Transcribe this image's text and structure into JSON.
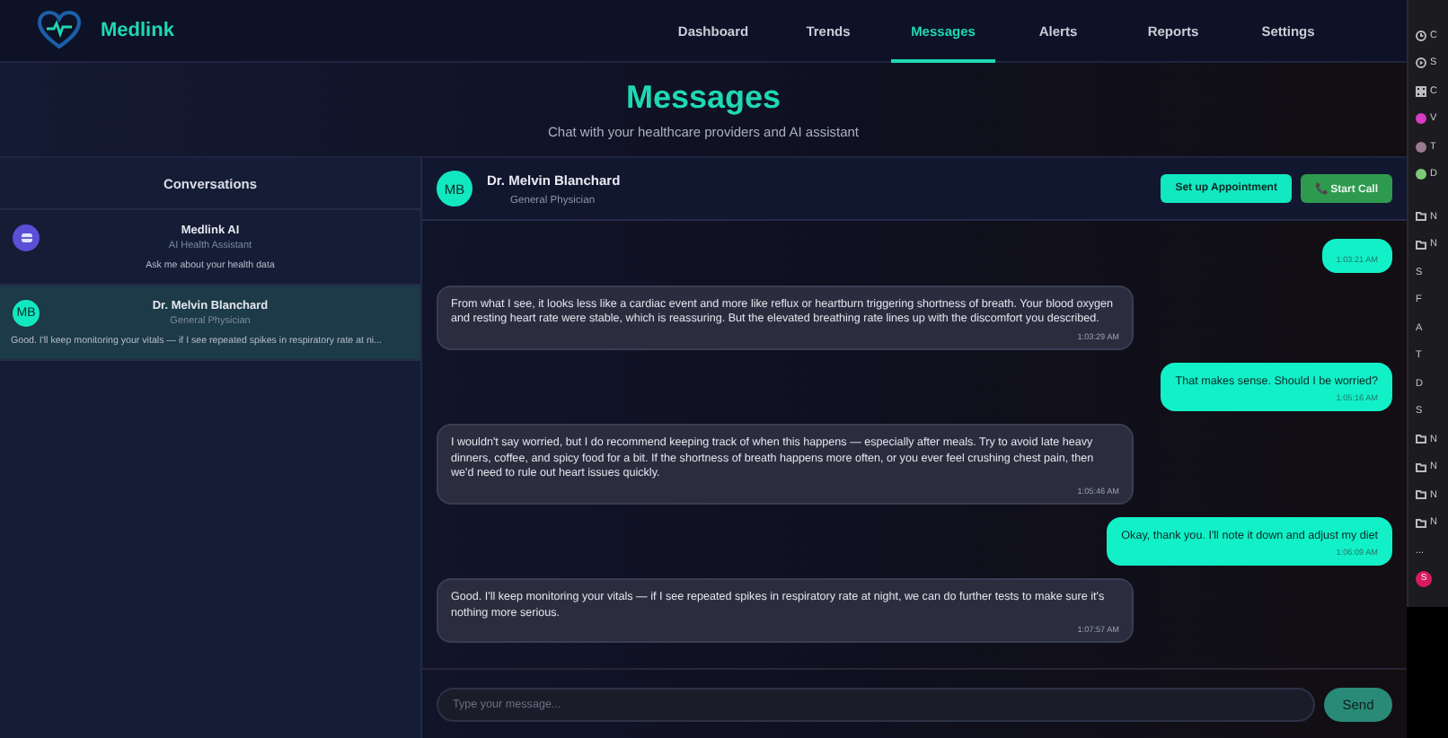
{
  "brand": {
    "name": "Medlink"
  },
  "nav": [
    {
      "label": "Dashboard",
      "selected": false
    },
    {
      "label": "Trends",
      "selected": false
    },
    {
      "label": "Messages",
      "selected": true
    },
    {
      "label": "Alerts",
      "selected": false
    },
    {
      "label": "Reports",
      "selected": false
    },
    {
      "label": "Settings",
      "selected": false
    }
  ],
  "page": {
    "title": "Messages",
    "subtitle": "Chat with your healthcare providers and AI assistant"
  },
  "conversations": {
    "title": "Conversations",
    "items": [
      {
        "kind": "ai",
        "name": "Medlink AI",
        "role": "AI Health Assistant",
        "preview": "Ask me about your health data",
        "selected": false
      },
      {
        "kind": "person",
        "initials": "MB",
        "name": "Dr. Melvin Blanchard",
        "role": "General Physician",
        "preview": "Good. I'll keep monitoring your vitals — if I see repeated spikes in respiratory rate at ni...",
        "selected": true
      }
    ]
  },
  "chat": {
    "initials": "MB",
    "name": "Dr. Melvin Blanchard",
    "role": "General Physician",
    "buttons": [
      {
        "kind": "secondary",
        "label": "Set up Appointment"
      },
      {
        "kind": "call",
        "icon": "📞",
        "label": "Start Call"
      }
    ],
    "messages": [
      {
        "kind": "user",
        "time": "1:03:21 AM"
      },
      {
        "kind": "provider",
        "text": "From what I see, it looks less like a cardiac event and more like reflux or heartburn triggering shortness of breath. Your blood oxygen and resting heart rate were stable, which is reassuring. But the elevated breathing rate lines up with the discomfort you described.",
        "time": "1:03:29 AM"
      },
      {
        "kind": "user",
        "text": "That makes sense. Should I be worried?",
        "time": "1:05:16 AM"
      },
      {
        "kind": "provider",
        "text": "I wouldn't say worried, but I do recommend keeping track of when this happens — especially after meals. Try to avoid late heavy dinners, coffee, and spicy food for a bit. If the shortness of breath happens more often, or you ever feel crushing chest pain, then we'd need to rule out heart issues quickly.",
        "time": "1:05:46 AM"
      },
      {
        "kind": "user",
        "text": "Okay, thank you. I'll note it down and adjust my diet",
        "time": "1:06:09 AM"
      },
      {
        "kind": "provider",
        "text": "Good. I'll keep monitoring your vitals — if I see repeated spikes in respiratory rate at night, we can do further tests to make sure it's nothing more serious.",
        "time": "1:07:57 AM"
      }
    ],
    "input": {
      "placeholder": "Type your message...",
      "send": "Send"
    }
  },
  "side_strip": [
    {
      "kind": "clock",
      "letter": "C"
    },
    {
      "kind": "play",
      "letter": "S"
    },
    {
      "kind": "grid",
      "letter": "C"
    },
    {
      "kind": "dot",
      "color": "#d63cc4",
      "letter": "V"
    },
    {
      "kind": "dot",
      "color": "#9a7a90",
      "letter": "T"
    },
    {
      "kind": "dot",
      "color": "#7fc97a",
      "letter": "D"
    },
    {
      "kind": "gap"
    },
    {
      "kind": "folder",
      "letter": "N"
    },
    {
      "kind": "folder",
      "letter": "N"
    },
    {
      "kind": "plain",
      "letter": "S"
    },
    {
      "kind": "plain",
      "letter": "F"
    },
    {
      "kind": "plain",
      "letter": "A"
    },
    {
      "kind": "plain",
      "letter": "T"
    },
    {
      "kind": "plain",
      "letter": "D"
    },
    {
      "kind": "plain",
      "letter": "S"
    },
    {
      "kind": "folder",
      "letter": "N"
    },
    {
      "kind": "folder",
      "letter": "N"
    },
    {
      "kind": "folder",
      "letter": "N"
    },
    {
      "kind": "folder",
      "letter": "N"
    },
    {
      "kind": "more",
      "letter": "..."
    },
    {
      "kind": "badge",
      "letter": "S"
    }
  ]
}
